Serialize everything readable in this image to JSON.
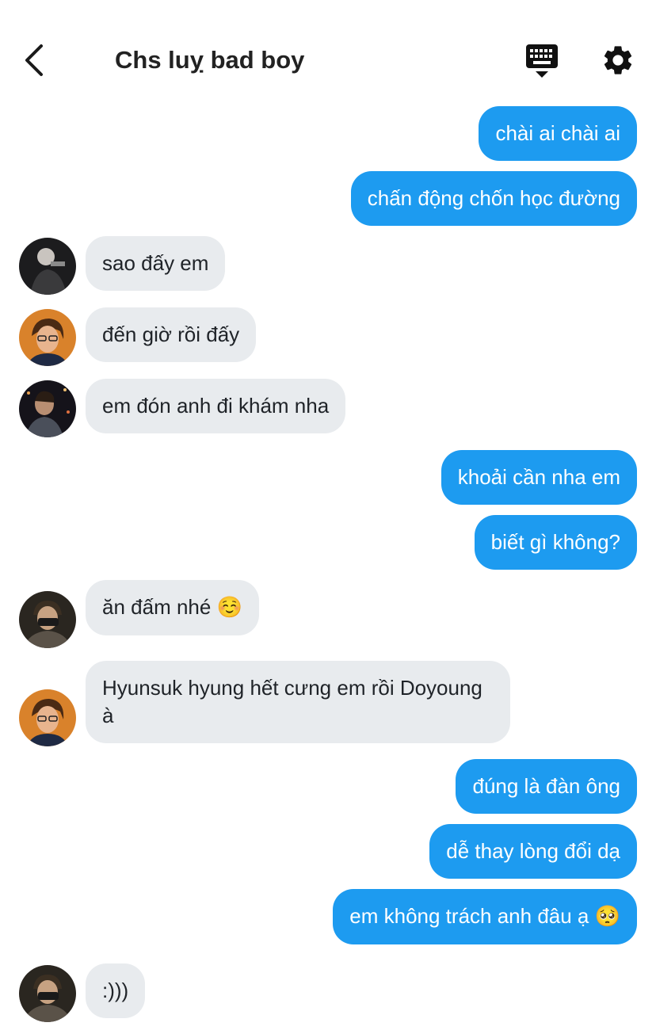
{
  "header": {
    "title": "Chs luỵ bad boy"
  },
  "messages": [
    {
      "text": "chài ai chài ai"
    },
    {
      "text": "chấn động chốn học đường"
    },
    {
      "text": "sao đấy em"
    },
    {
      "text": "đến giờ rồi đấy"
    },
    {
      "text": "em đón anh đi khám nha"
    },
    {
      "text": "khoải cần nha em"
    },
    {
      "text": "biết gì không?"
    },
    {
      "text": "ăn đấm nhé",
      "emoji": "☺️"
    },
    {
      "text": "Hyunsuk hyung hết cưng em rồi Doyoung à"
    },
    {
      "text": "đúng là đàn ông"
    },
    {
      "text": "dễ thay lòng đổi dạ"
    },
    {
      "text": "em không trách anh đâu ạ",
      "emoji": "🥺"
    },
    {
      "text": ":)))"
    }
  ],
  "colors": {
    "sent_bubble": "#1d9bf0",
    "received_bubble": "#e8ebee",
    "sent_text": "#ffffff",
    "received_text": "#1f2328"
  }
}
